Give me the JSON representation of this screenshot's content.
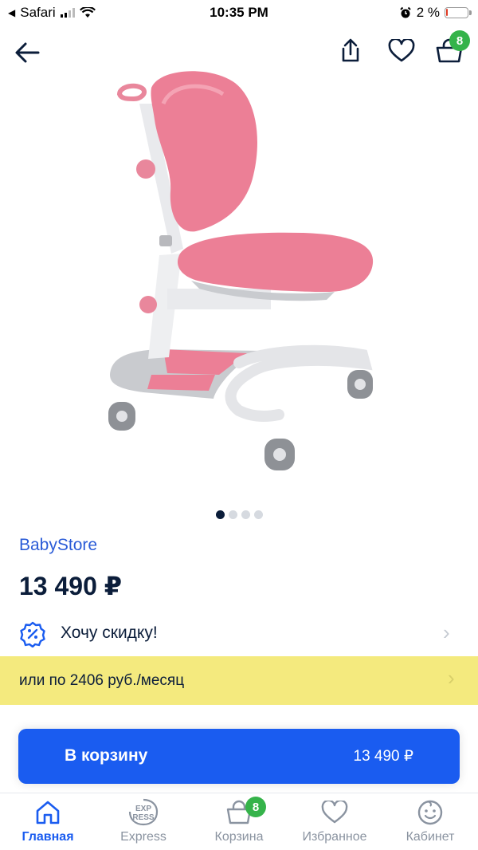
{
  "status_bar": {
    "back_app": "Safari",
    "time": "10:35 PM",
    "battery_percent": "2 %",
    "battery_level": 0.02
  },
  "header": {
    "cart_count": "8"
  },
  "gallery": {
    "image_count": 4,
    "active_index": 0
  },
  "product": {
    "seller": "BabyStore",
    "price": "13 490 ₽"
  },
  "discount": {
    "label": "Хочу скидку!"
  },
  "installment": {
    "label": "или по 2406 руб./месяц"
  },
  "cta": {
    "label": "В корзину",
    "price": "13 490 ₽"
  },
  "tabbar": {
    "tabs": [
      {
        "label": "Главная",
        "icon": "home-icon",
        "active": true
      },
      {
        "label": "Express",
        "icon": "express-icon",
        "active": false
      },
      {
        "label": "Корзина",
        "icon": "cart-icon",
        "active": false,
        "badge": "8"
      },
      {
        "label": "Избранное",
        "icon": "heart-icon",
        "active": false
      },
      {
        "label": "Кабинет",
        "icon": "profile-icon",
        "active": false
      }
    ],
    "express_icon_text": [
      "EXP",
      "RESS"
    ]
  },
  "colors": {
    "accent": "#1a5cf0",
    "seller_link": "#2a5bd7",
    "badge": "#35b34a",
    "installment_bg": "#f4ea7e",
    "dark_text": "#0b1d3a",
    "chair_pink": "#ec7f96",
    "chair_frame": "#e6e7ea"
  }
}
